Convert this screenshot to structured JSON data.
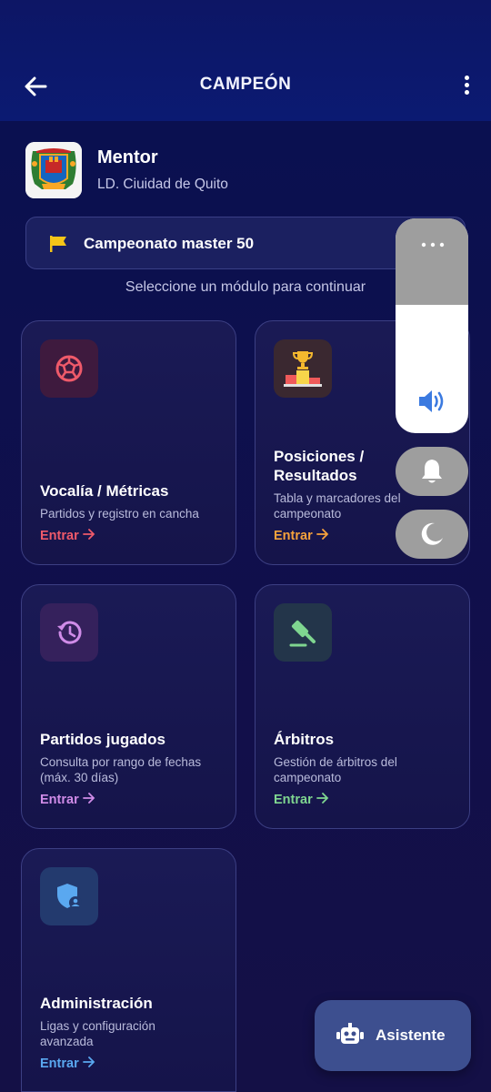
{
  "header": {
    "title": "CAMPEÓN",
    "back_icon": "arrow-left-icon",
    "menu_icon": "more-vertical-icon"
  },
  "organization": {
    "name": "Mentor",
    "league": "LD. Ciuidad de Quito",
    "logo_icon": "coat-of-arms-logo"
  },
  "championship": {
    "name": "Campeonato master 50",
    "icon": "flag-icon",
    "accent": "#f5c518"
  },
  "hint": "Seleccione un módulo para continuar",
  "modules": [
    {
      "title": "Vocalía / Métricas",
      "description": "Partidos y registro en cancha",
      "link": "Entrar",
      "icon": "soccer-ball-icon",
      "color": "#ef5a6a"
    },
    {
      "title": "Posiciones / Resultados",
      "title_line1": "Posiciones /",
      "title_line2": "Resultados",
      "description": "Tabla y marcadores del campeonato",
      "link": "Entrar",
      "icon": "podium-trophy-icon",
      "color": "#f6a23c"
    },
    {
      "title": "Partidos jugados",
      "description": "Consulta por rango de fechas (máx. 30 días)",
      "link": "Entrar",
      "icon": "history-clock-icon",
      "color": "#d08ce8"
    },
    {
      "title": "Árbitros",
      "description": "Gestión de árbitros del campeonato",
      "link": "Entrar",
      "icon": "gavel-icon",
      "color": "#7fd690"
    },
    {
      "title": "Administración",
      "description": "Ligas y configuración avanzada",
      "link": "Entrar",
      "icon": "shield-user-icon",
      "color": "#5aa8f0"
    }
  ],
  "volume_overlay": {
    "level": 0.6,
    "icon": "speaker-icon",
    "more_icon": "more-horizontal-icon",
    "bell_icon": "bell-icon",
    "dnd_icon": "moon-icon"
  },
  "assistant": {
    "label": "Asistente",
    "icon": "robot-icon"
  }
}
